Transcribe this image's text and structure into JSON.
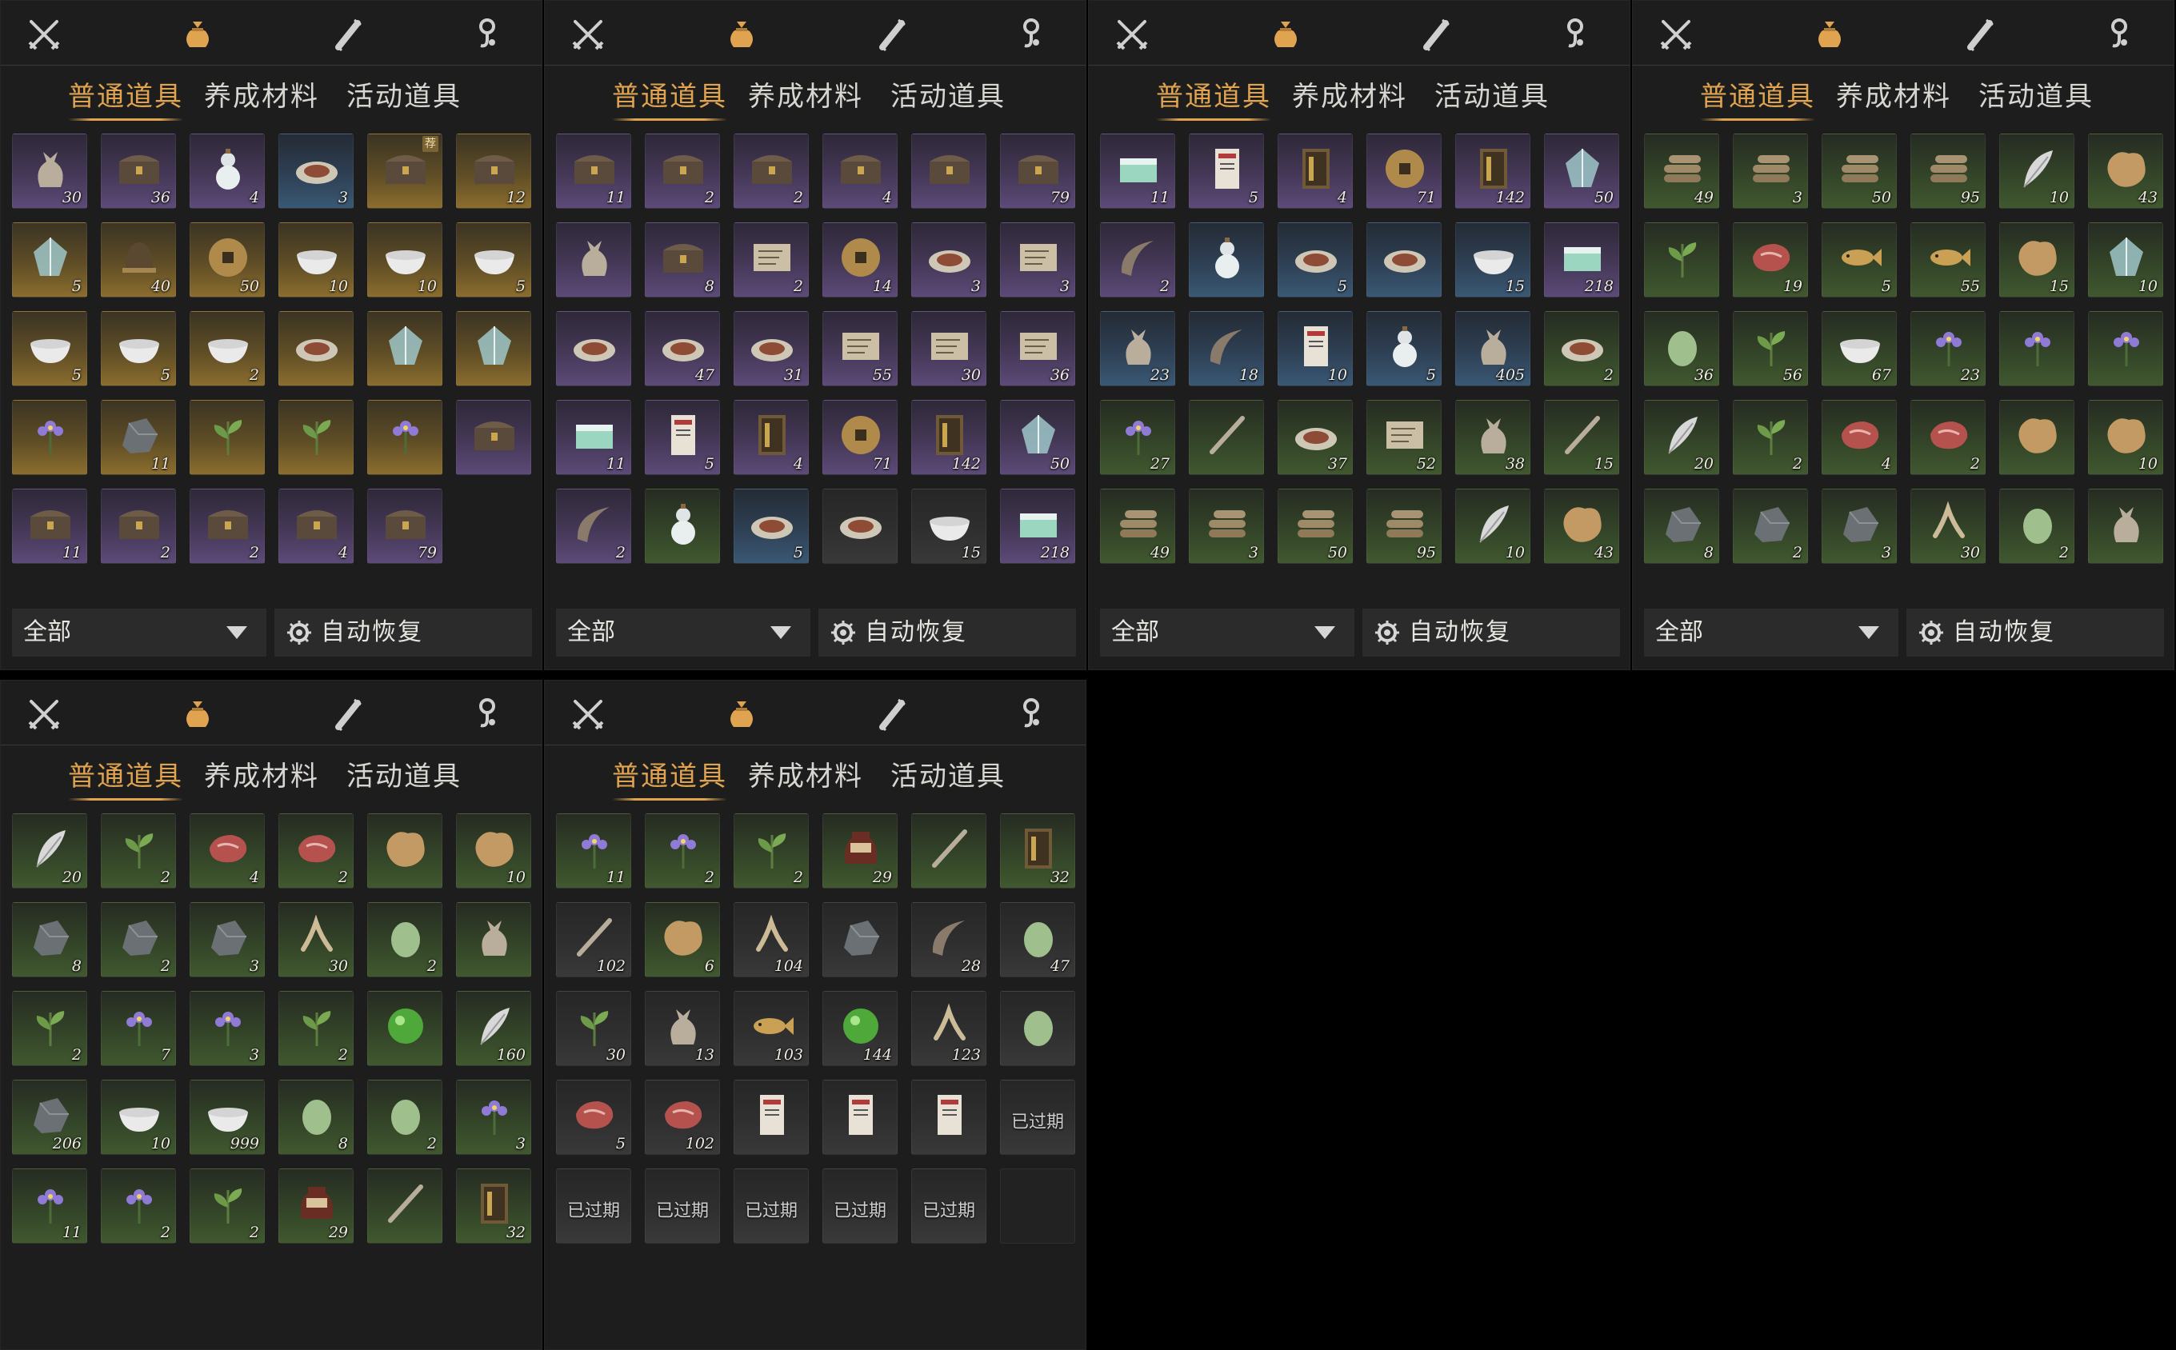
{
  "colors": {
    "accent": "#e0a451",
    "text": "#d8d6d0",
    "panel": "#1d1d1d"
  },
  "top_icons": [
    "crossed-swords-icon",
    "pouch-icon",
    "scroll-icon",
    "hook-icon"
  ],
  "panels": [
    {
      "tabs": [
        "普通道具",
        "养成材料",
        "活动道具"
      ],
      "filter_label": "全部",
      "auto_restore_label": "自动恢复",
      "items": [
        {
          "q": "30",
          "r": "purple",
          "i": "sack"
        },
        {
          "q": "36",
          "r": "purple",
          "i": "chest"
        },
        {
          "q": "4",
          "r": "purple",
          "i": "gourd"
        },
        {
          "q": "3",
          "r": "blue",
          "i": "plate"
        },
        {
          "q": "",
          "r": "gold",
          "i": "chest",
          "b": "荐"
        },
        {
          "q": "12",
          "r": "gold",
          "i": "chest"
        },
        {
          "q": "5",
          "r": "gold",
          "i": "crystal"
        },
        {
          "q": "40",
          "r": "gold",
          "i": "bell"
        },
        {
          "q": "50",
          "r": "gold",
          "i": "coin"
        },
        {
          "q": "10",
          "r": "gold",
          "i": "bowl"
        },
        {
          "q": "10",
          "r": "gold",
          "i": "bowl"
        },
        {
          "q": "5",
          "r": "gold",
          "i": "bowl"
        },
        {
          "q": "5",
          "r": "gold",
          "i": "bowl"
        },
        {
          "q": "5",
          "r": "gold",
          "i": "bowl"
        },
        {
          "q": "2",
          "r": "gold",
          "i": "bowl"
        },
        {
          "q": "",
          "r": "gold",
          "i": "plate"
        },
        {
          "q": "",
          "r": "gold",
          "i": "crystal"
        },
        {
          "q": "",
          "r": "gold",
          "i": "crystal"
        },
        {
          "q": "",
          "r": "gold",
          "i": "flower"
        },
        {
          "q": "11",
          "r": "gold",
          "i": "ore"
        },
        {
          "q": "",
          "r": "gold",
          "i": "leaf"
        },
        {
          "q": "",
          "r": "gold",
          "i": "leaf"
        },
        {
          "q": "",
          "r": "gold",
          "i": "flower"
        },
        {
          "q": "",
          "r": "purple",
          "i": "chest"
        },
        {
          "q": "11",
          "r": "purple",
          "i": "chest"
        },
        {
          "q": "2",
          "r": "purple",
          "i": "chest"
        },
        {
          "q": "2",
          "r": "purple",
          "i": "chest"
        },
        {
          "q": "4",
          "r": "purple",
          "i": "chest"
        },
        {
          "q": "79",
          "r": "purple",
          "i": "chest"
        }
      ]
    },
    {
      "tabs": [
        "普通道具",
        "养成材料",
        "活动道具"
      ],
      "filter_label": "全部",
      "auto_restore_label": "自动恢复",
      "items": [
        {
          "q": "11",
          "r": "purple",
          "i": "chest"
        },
        {
          "q": "2",
          "r": "purple",
          "i": "chest"
        },
        {
          "q": "2",
          "r": "purple",
          "i": "chest"
        },
        {
          "q": "4",
          "r": "purple",
          "i": "chest"
        },
        {
          "q": "",
          "r": "purple",
          "i": "chest"
        },
        {
          "q": "79",
          "r": "purple",
          "i": "chest"
        },
        {
          "q": "",
          "r": "purple",
          "i": "sack"
        },
        {
          "q": "8",
          "r": "purple",
          "i": "chest"
        },
        {
          "q": "2",
          "r": "purple",
          "i": "scroll"
        },
        {
          "q": "14",
          "r": "purple",
          "i": "coin"
        },
        {
          "q": "3",
          "r": "purple",
          "i": "plate"
        },
        {
          "q": "3",
          "r": "purple",
          "i": "scroll"
        },
        {
          "q": "",
          "r": "purple",
          "i": "plate"
        },
        {
          "q": "47",
          "r": "purple",
          "i": "plate"
        },
        {
          "q": "31",
          "r": "purple",
          "i": "plate"
        },
        {
          "q": "55",
          "r": "purple",
          "i": "scroll"
        },
        {
          "q": "30",
          "r": "purple",
          "i": "scroll"
        },
        {
          "q": "36",
          "r": "purple",
          "i": "scroll"
        },
        {
          "q": "11",
          "r": "purple",
          "i": "box"
        },
        {
          "q": "5",
          "r": "purple",
          "i": "card"
        },
        {
          "q": "4",
          "r": "purple",
          "i": "book"
        },
        {
          "q": "71",
          "r": "purple",
          "i": "coin"
        },
        {
          "q": "142",
          "r": "purple",
          "i": "book"
        },
        {
          "q": "50",
          "r": "purple",
          "i": "crystal"
        },
        {
          "q": "2",
          "r": "purple",
          "i": "horn"
        },
        {
          "q": "",
          "r": "green",
          "i": "gourd"
        },
        {
          "q": "5",
          "r": "blue",
          "i": "plate"
        },
        {
          "q": "",
          "r": "grey",
          "i": "plate"
        },
        {
          "q": "15",
          "r": "grey",
          "i": "bowl"
        },
        {
          "q": "218",
          "r": "purple",
          "i": "box"
        }
      ]
    },
    {
      "tabs": [
        "普通道具",
        "养成材料",
        "活动道具"
      ],
      "filter_label": "全部",
      "auto_restore_label": "自动恢复",
      "items": [
        {
          "q": "11",
          "r": "purple",
          "i": "box"
        },
        {
          "q": "5",
          "r": "purple",
          "i": "card"
        },
        {
          "q": "4",
          "r": "purple",
          "i": "book"
        },
        {
          "q": "71",
          "r": "purple",
          "i": "coin"
        },
        {
          "q": "142",
          "r": "purple",
          "i": "book"
        },
        {
          "q": "50",
          "r": "purple",
          "i": "crystal"
        },
        {
          "q": "2",
          "r": "purple",
          "i": "horn"
        },
        {
          "q": "",
          "r": "blue",
          "i": "gourd"
        },
        {
          "q": "5",
          "r": "blue",
          "i": "plate"
        },
        {
          "q": "",
          "r": "blue",
          "i": "plate"
        },
        {
          "q": "15",
          "r": "blue",
          "i": "bowl"
        },
        {
          "q": "218",
          "r": "purple",
          "i": "box"
        },
        {
          "q": "23",
          "r": "blue",
          "i": "sack"
        },
        {
          "q": "18",
          "r": "blue",
          "i": "horn"
        },
        {
          "q": "10",
          "r": "blue",
          "i": "card"
        },
        {
          "q": "5",
          "r": "blue",
          "i": "gourd"
        },
        {
          "q": "405",
          "r": "blue",
          "i": "sack"
        },
        {
          "q": "2",
          "r": "green",
          "i": "plate"
        },
        {
          "q": "27",
          "r": "green",
          "i": "flower"
        },
        {
          "q": "",
          "r": "green",
          "i": "stick"
        },
        {
          "q": "37",
          "r": "green",
          "i": "plate"
        },
        {
          "q": "52",
          "r": "green",
          "i": "scroll"
        },
        {
          "q": "38",
          "r": "green",
          "i": "sack"
        },
        {
          "q": "15",
          "r": "green",
          "i": "stick"
        },
        {
          "q": "49",
          "r": "green",
          "i": "wood"
        },
        {
          "q": "3",
          "r": "green",
          "i": "wood"
        },
        {
          "q": "50",
          "r": "green",
          "i": "wood"
        },
        {
          "q": "95",
          "r": "green",
          "i": "wood"
        },
        {
          "q": "10",
          "r": "green",
          "i": "feather"
        },
        {
          "q": "43",
          "r": "green",
          "i": "pelt"
        }
      ]
    },
    {
      "tabs": [
        "普通道具",
        "养成材料",
        "活动道具"
      ],
      "filter_label": "全部",
      "auto_restore_label": "自动恢复",
      "items": [
        {
          "q": "49",
          "r": "green",
          "i": "wood"
        },
        {
          "q": "3",
          "r": "green",
          "i": "wood"
        },
        {
          "q": "50",
          "r": "green",
          "i": "wood"
        },
        {
          "q": "95",
          "r": "green",
          "i": "wood"
        },
        {
          "q": "10",
          "r": "green",
          "i": "feather"
        },
        {
          "q": "43",
          "r": "green",
          "i": "pelt"
        },
        {
          "q": "",
          "r": "green",
          "i": "leaf"
        },
        {
          "q": "19",
          "r": "green",
          "i": "meat"
        },
        {
          "q": "5",
          "r": "green",
          "i": "fish"
        },
        {
          "q": "55",
          "r": "green",
          "i": "fish"
        },
        {
          "q": "15",
          "r": "green",
          "i": "pelt"
        },
        {
          "q": "10",
          "r": "green",
          "i": "crystal"
        },
        {
          "q": "36",
          "r": "green",
          "i": "egg"
        },
        {
          "q": "56",
          "r": "green",
          "i": "leaf"
        },
        {
          "q": "67",
          "r": "green",
          "i": "bowl"
        },
        {
          "q": "23",
          "r": "green",
          "i": "flower"
        },
        {
          "q": "",
          "r": "green",
          "i": "flower"
        },
        {
          "q": "",
          "r": "green",
          "i": "flower"
        },
        {
          "q": "20",
          "r": "green",
          "i": "feather"
        },
        {
          "q": "2",
          "r": "green",
          "i": "leaf"
        },
        {
          "q": "4",
          "r": "green",
          "i": "meat"
        },
        {
          "q": "2",
          "r": "green",
          "i": "meat"
        },
        {
          "q": "",
          "r": "green",
          "i": "pelt"
        },
        {
          "q": "10",
          "r": "green",
          "i": "pelt"
        },
        {
          "q": "8",
          "r": "green",
          "i": "ore"
        },
        {
          "q": "2",
          "r": "green",
          "i": "ore"
        },
        {
          "q": "3",
          "r": "green",
          "i": "ore"
        },
        {
          "q": "30",
          "r": "green",
          "i": "root"
        },
        {
          "q": "2",
          "r": "green",
          "i": "egg"
        },
        {
          "q": "",
          "r": "green",
          "i": "sack"
        }
      ]
    },
    {
      "tabs": [
        "普通道具",
        "养成材料",
        "活动道具"
      ],
      "filter_label": "",
      "auto_restore_label": "",
      "items": [
        {
          "q": "20",
          "r": "green",
          "i": "feather"
        },
        {
          "q": "2",
          "r": "green",
          "i": "leaf"
        },
        {
          "q": "4",
          "r": "green",
          "i": "meat"
        },
        {
          "q": "2",
          "r": "green",
          "i": "meat"
        },
        {
          "q": "",
          "r": "green",
          "i": "pelt"
        },
        {
          "q": "10",
          "r": "green",
          "i": "pelt"
        },
        {
          "q": "8",
          "r": "green",
          "i": "ore"
        },
        {
          "q": "2",
          "r": "green",
          "i": "ore"
        },
        {
          "q": "3",
          "r": "green",
          "i": "ore"
        },
        {
          "q": "30",
          "r": "green",
          "i": "root"
        },
        {
          "q": "2",
          "r": "green",
          "i": "egg"
        },
        {
          "q": "",
          "r": "green",
          "i": "sack"
        },
        {
          "q": "2",
          "r": "green",
          "i": "leaf"
        },
        {
          "q": "7",
          "r": "green",
          "i": "flower"
        },
        {
          "q": "3",
          "r": "green",
          "i": "flower"
        },
        {
          "q": "2",
          "r": "green",
          "i": "leaf"
        },
        {
          "q": "",
          "r": "green",
          "i": "orb"
        },
        {
          "q": "160",
          "r": "green",
          "i": "feather"
        },
        {
          "q": "206",
          "r": "green",
          "i": "ore"
        },
        {
          "q": "10",
          "r": "green",
          "i": "bowl"
        },
        {
          "q": "999",
          "r": "green",
          "i": "bowl"
        },
        {
          "q": "8",
          "r": "green",
          "i": "egg"
        },
        {
          "q": "2",
          "r": "green",
          "i": "egg"
        },
        {
          "q": "3",
          "r": "green",
          "i": "flower"
        },
        {
          "q": "11",
          "r": "green",
          "i": "flower"
        },
        {
          "q": "2",
          "r": "green",
          "i": "flower"
        },
        {
          "q": "2",
          "r": "green",
          "i": "leaf"
        },
        {
          "q": "29",
          "r": "green",
          "i": "jar"
        },
        {
          "q": "",
          "r": "green",
          "i": "stick"
        },
        {
          "q": "32",
          "r": "green",
          "i": "book"
        }
      ]
    },
    {
      "tabs": [
        "普通道具",
        "养成材料",
        "活动道具"
      ],
      "filter_label": "",
      "auto_restore_label": "",
      "expired_label": "已过期",
      "items": [
        {
          "q": "11",
          "r": "green",
          "i": "flower"
        },
        {
          "q": "2",
          "r": "green",
          "i": "flower"
        },
        {
          "q": "2",
          "r": "green",
          "i": "leaf"
        },
        {
          "q": "29",
          "r": "green",
          "i": "jar"
        },
        {
          "q": "",
          "r": "green",
          "i": "stick"
        },
        {
          "q": "32",
          "r": "green",
          "i": "book"
        },
        {
          "q": "102",
          "r": "grey",
          "i": "stick"
        },
        {
          "q": "6",
          "r": "green",
          "i": "pelt"
        },
        {
          "q": "104",
          "r": "grey",
          "i": "root"
        },
        {
          "q": "",
          "r": "grey",
          "i": "ore"
        },
        {
          "q": "28",
          "r": "grey",
          "i": "horn"
        },
        {
          "q": "47",
          "r": "grey",
          "i": "egg"
        },
        {
          "q": "30",
          "r": "grey",
          "i": "leaf"
        },
        {
          "q": "13",
          "r": "grey",
          "i": "sack"
        },
        {
          "q": "103",
          "r": "grey",
          "i": "fish"
        },
        {
          "q": "144",
          "r": "grey",
          "i": "orb"
        },
        {
          "q": "123",
          "r": "grey",
          "i": "root"
        },
        {
          "q": "",
          "r": "grey",
          "i": "egg"
        },
        {
          "q": "5",
          "r": "grey",
          "i": "meat"
        },
        {
          "q": "102",
          "r": "grey",
          "i": "meat"
        },
        {
          "q": "",
          "r": "grey",
          "i": "card"
        },
        {
          "q": "",
          "r": "grey",
          "i": "card"
        },
        {
          "q": "",
          "r": "grey",
          "i": "card"
        },
        {
          "q": "",
          "r": "grey",
          "i": "expired"
        },
        {
          "q": "",
          "r": "grey",
          "i": "expired"
        },
        {
          "q": "",
          "r": "grey",
          "i": "expired"
        },
        {
          "q": "",
          "r": "grey",
          "i": "expired"
        },
        {
          "q": "",
          "r": "grey",
          "i": "expired"
        },
        {
          "q": "",
          "r": "grey",
          "i": "expired"
        },
        {
          "q": "",
          "r": "empty",
          "i": ""
        }
      ]
    }
  ]
}
